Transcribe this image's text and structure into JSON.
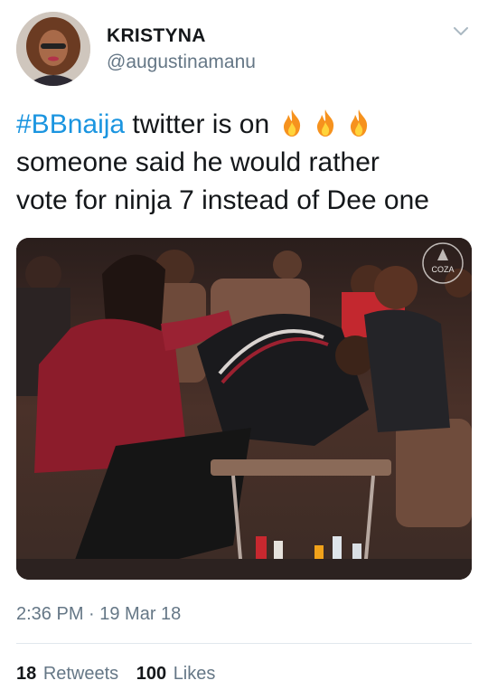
{
  "user": {
    "name": "KRISTYNA",
    "handle": "@augustinamanu"
  },
  "tweet": {
    "hashtag": "#BBnaija",
    "line1_rest": " twitter is on",
    "line2": "someone said he would rather",
    "line3": "vote for ninja 7 instead of Dee one",
    "emoji": [
      "fire-icon",
      "fire-icon",
      "fire-icon"
    ]
  },
  "photo": {
    "watermark": "COZA"
  },
  "meta": {
    "timestamp": "2:36 PM · 19 Mar 18"
  },
  "stats": {
    "retweets_count": "18",
    "retweets_label": "Retweets",
    "likes_count": "100",
    "likes_label": "Likes"
  },
  "colors": {
    "link": "#1b95e0",
    "secondary_text": "#657786",
    "primary_text": "#14171a",
    "divider": "#e1e8ed"
  }
}
